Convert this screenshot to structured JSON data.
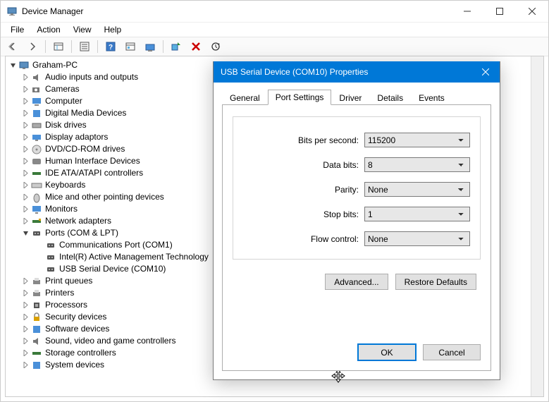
{
  "window": {
    "title": "Device Manager"
  },
  "menubar": {
    "file": "File",
    "action": "Action",
    "view": "View",
    "help": "Help"
  },
  "tree": {
    "root": "Graham-PC",
    "items": [
      "Audio inputs and outputs",
      "Cameras",
      "Computer",
      "Digital Media Devices",
      "Disk drives",
      "Display adaptors",
      "DVD/CD-ROM drives",
      "Human Interface Devices",
      "IDE ATA/ATAPI controllers",
      "Keyboards",
      "Mice and other pointing devices",
      "Monitors",
      "Network adapters"
    ],
    "ports": {
      "label": "Ports (COM & LPT)",
      "children": [
        "Communications Port (COM1)",
        "Intel(R) Active Management Technology",
        "USB Serial Device (COM10)"
      ]
    },
    "items2": [
      "Print queues",
      "Printers",
      "Processors",
      "Security devices",
      "Software devices",
      "Sound, video and game controllers",
      "Storage controllers",
      "System devices"
    ]
  },
  "dialog": {
    "title": "USB Serial Device (COM10) Properties",
    "tabs": {
      "general": "General",
      "port": "Port Settings",
      "driver": "Driver",
      "details": "Details",
      "events": "Events"
    },
    "labels": {
      "bps": "Bits per second:",
      "databits": "Data bits:",
      "parity": "Parity:",
      "stopbits": "Stop bits:",
      "flow": "Flow control:"
    },
    "values": {
      "bps": "115200",
      "databits": "8",
      "parity": "None",
      "stopbits": "1",
      "flow": "None"
    },
    "buttons": {
      "advanced": "Advanced...",
      "restore": "Restore Defaults",
      "ok": "OK",
      "cancel": "Cancel"
    }
  }
}
